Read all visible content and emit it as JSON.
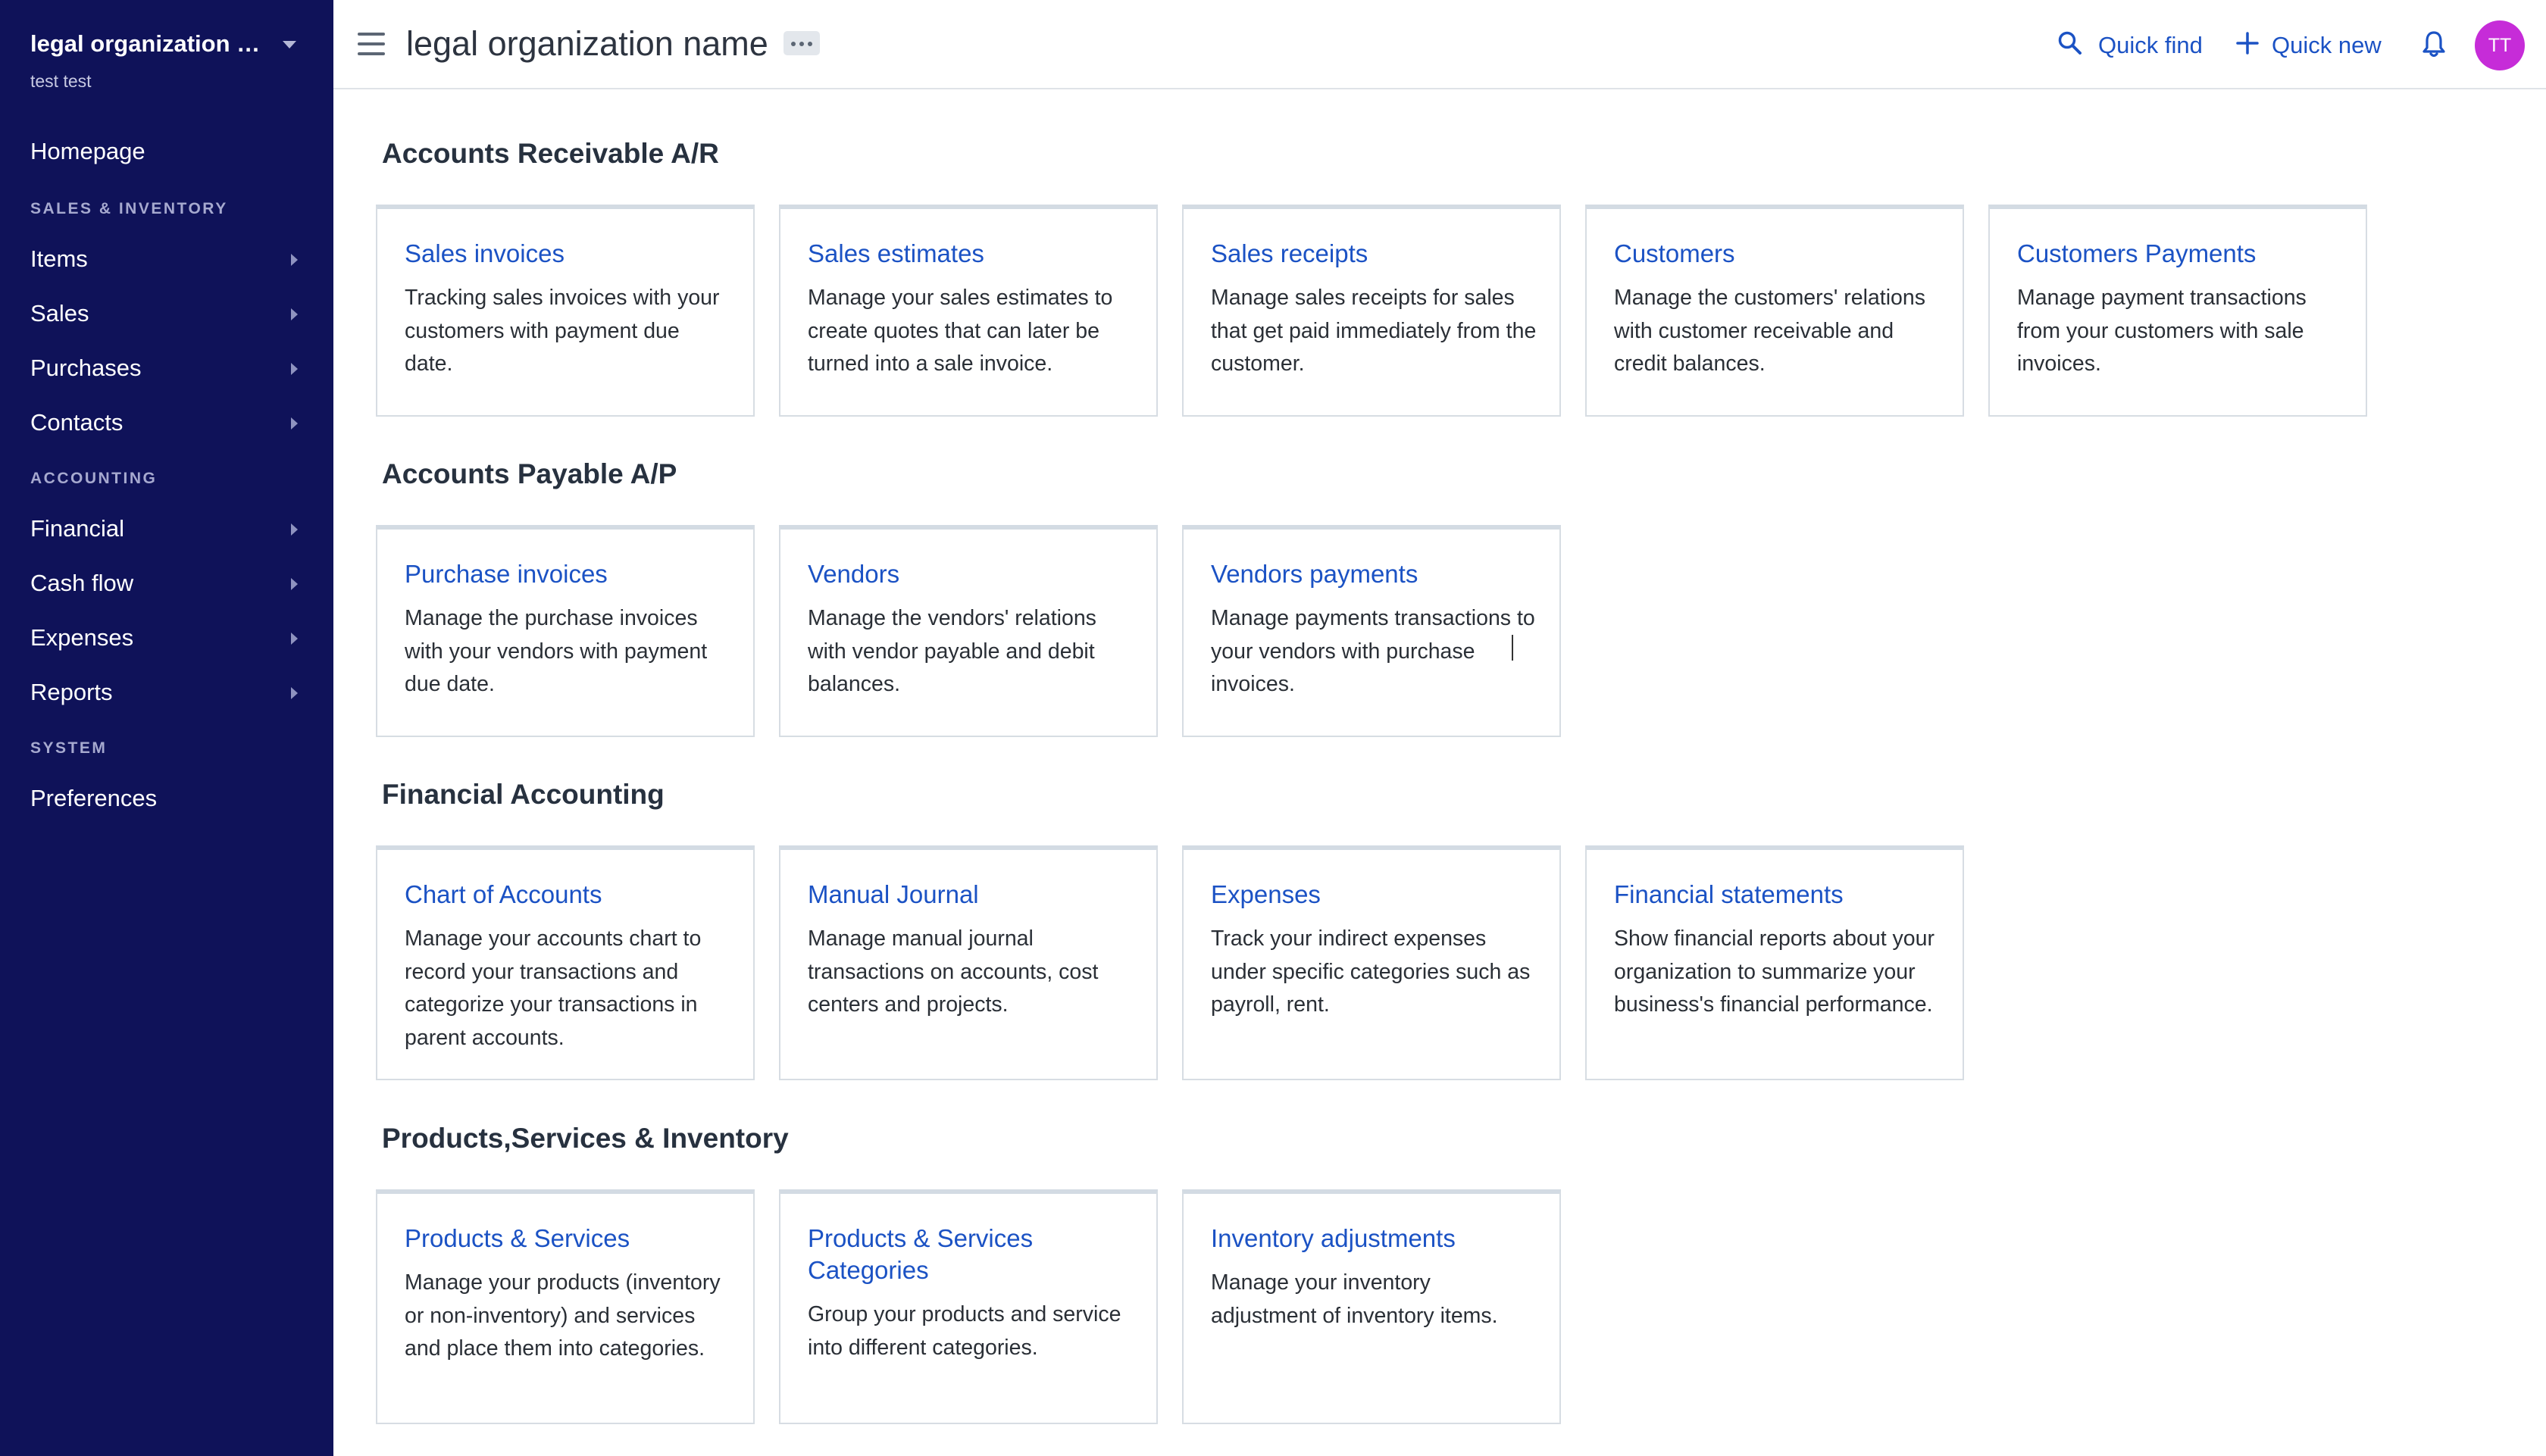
{
  "sidebar": {
    "org_name": "legal organization n...",
    "user_name": "test test",
    "homepage": "Homepage",
    "sections": {
      "sales_inventory": "SALES & INVENTORY",
      "accounting": "ACCOUNTING",
      "system": "SYSTEM"
    },
    "items": {
      "items": "Items",
      "sales": "Sales",
      "purchases": "Purchases",
      "contacts": "Contacts",
      "financial": "Financial",
      "cash_flow": "Cash flow",
      "expenses": "Expenses",
      "reports": "Reports",
      "preferences": "Preferences"
    }
  },
  "header": {
    "title": "legal organization name",
    "quick_find": "Quick find",
    "quick_new": "Quick new",
    "avatar_initials": "TT"
  },
  "sections": [
    {
      "title": "Accounts Receivable A/R",
      "cards": [
        {
          "title": "Sales invoices",
          "description": "Tracking sales invoices with your customers with payment due date."
        },
        {
          "title": "Sales estimates",
          "description": "Manage your sales estimates to create quotes that can later be turned into a sale invoice."
        },
        {
          "title": "Sales receipts",
          "description": "Manage sales receipts for sales that get paid immediately from the customer."
        },
        {
          "title": "Customers",
          "description": "Manage the customers' relations with customer receivable and credit balances."
        },
        {
          "title": "Customers Payments",
          "description": "Manage payment transactions from your customers with sale invoices."
        }
      ]
    },
    {
      "title": "Accounts Payable A/P",
      "cards": [
        {
          "title": "Purchase invoices",
          "description": "Manage the purchase invoices with your vendors with payment due date."
        },
        {
          "title": "Vendors",
          "description": "Manage the vendors' relations with vendor payable and debit balances."
        },
        {
          "title": "Vendors payments",
          "description": "Manage payments transactions to your vendors with purchase invoices."
        }
      ]
    },
    {
      "title": "Financial Accounting",
      "cards": [
        {
          "title": "Chart of Accounts",
          "description": "Manage your accounts chart to record your transactions and categorize your transactions in parent accounts."
        },
        {
          "title": "Manual Journal",
          "description": "Manage manual journal transactions on accounts, cost centers and projects."
        },
        {
          "title": "Expenses",
          "description": "Track your indirect expenses under specific categories such as payroll, rent."
        },
        {
          "title": "Financial statements",
          "description": "Show financial reports about your organization to summarize your business's financial performance."
        }
      ]
    },
    {
      "title": "Products,Services & Inventory",
      "cards": [
        {
          "title": "Products & Services",
          "description": "Manage your products (inventory or non-inventory) and services and place them into categories."
        },
        {
          "title": "Products & Services Categories",
          "description": "Group your products and service into different categories."
        },
        {
          "title": "Inventory adjustments",
          "description": "Manage your inventory adjustment of inventory items."
        }
      ]
    }
  ],
  "colors": {
    "sidebar_bg": "#0f1259",
    "link": "#1b52c4",
    "avatar": "#c62cd8"
  }
}
